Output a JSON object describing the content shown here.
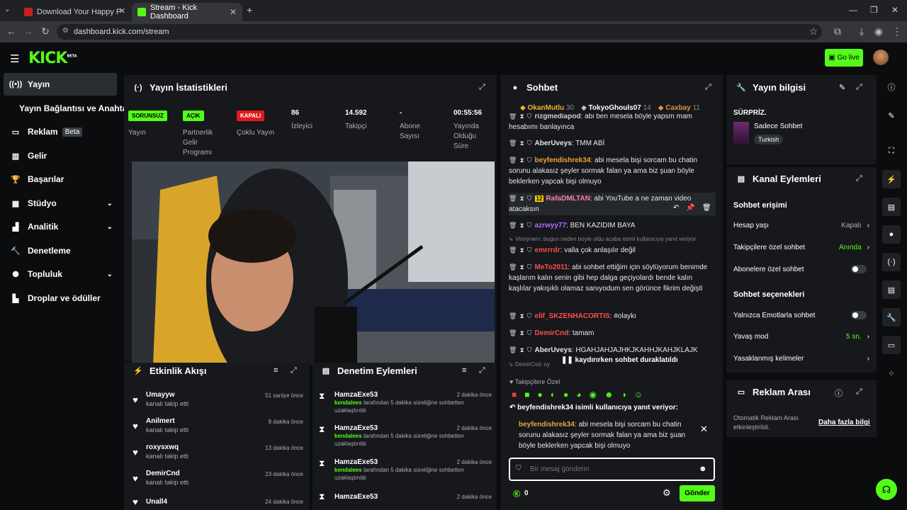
{
  "browser": {
    "tabs": [
      {
        "title": "Download Your Happy Place by",
        "active": false
      },
      {
        "title": "Stream - Kick Dashboard",
        "active": true
      }
    ],
    "url": "dashboard.kick.com/stream"
  },
  "header": {
    "logo": "KICK",
    "logo_tag": "BETA",
    "go_live": "Go live",
    "accent": "#53fc18"
  },
  "sidebar": {
    "items": [
      {
        "label": "Yayın",
        "icon": "broadcast-icon",
        "selected": true
      },
      {
        "label": "Yayın Bağlantısı ve Anahtarı",
        "icon": "",
        "selected": false
      },
      {
        "label": "Reklam",
        "icon": "ad-icon",
        "badge": "Beta"
      },
      {
        "label": "Gelir",
        "icon": "chart-icon"
      },
      {
        "label": "Başarılar",
        "icon": "trophy-icon"
      },
      {
        "label": "Stüdyo",
        "icon": "studio-icon",
        "chevron": true
      },
      {
        "label": "Analitik",
        "icon": "analytics-icon",
        "chevron": true
      },
      {
        "label": "Denetleme",
        "icon": "hammer-icon"
      },
      {
        "label": "Topluluk",
        "icon": "community-icon",
        "chevron": true
      },
      {
        "label": "Droplar ve ödüller",
        "icon": "drops-icon"
      }
    ]
  },
  "stats": {
    "title": "Yayın İstatistikleri",
    "items": [
      {
        "value": "SORUNSUZ",
        "label": "Yayın",
        "pill": "green"
      },
      {
        "value": "AÇIK",
        "label": "Partnerlik Gelir Programı",
        "pill": "green"
      },
      {
        "value": "KAPALI",
        "label": "Çoklu Yayın",
        "pill": "red"
      },
      {
        "value": "86",
        "label": "İzleyici"
      },
      {
        "value": "14.592",
        "label": "Takipçi"
      },
      {
        "value": "-",
        "label": "Abone Sayısı"
      },
      {
        "value": "00:55:56",
        "label": "Yayında Olduğu Süre"
      }
    ]
  },
  "activity": {
    "title": "Etkinlik Akışı",
    "items": [
      {
        "user": "Umayyw",
        "text": "kanalı takip etti",
        "time": "51 saniye önce"
      },
      {
        "user": "Anilmert",
        "text": "kanalı takip etti",
        "time": "9 dakika önce"
      },
      {
        "user": "roxysxwq",
        "text": "kanalı takip etti",
        "time": "13 dakika önce"
      },
      {
        "user": "DemirCnd",
        "text": "kanalı takip etti",
        "time": "23 dakika önce"
      },
      {
        "user": "Unall4",
        "text": "",
        "time": "24 dakika önce"
      }
    ]
  },
  "moderation": {
    "title": "Denetim Eylemleri",
    "items": [
      {
        "user": "HamzaExe53",
        "time": "2 dakika önce",
        "target": "kendalees",
        "text": "tarafından 5 dakika süreliğine sohbetten uzaklaştırıldı"
      },
      {
        "user": "HamzaExe53",
        "time": "2 dakika önce",
        "target": "kendalees",
        "text": "tarafından 5 dakika süreliğine sohbetten uzaklaştırıldı"
      },
      {
        "user": "HamzaExe53",
        "time": "2 dakika önce",
        "target": "kendalees",
        "text": "tarafından 5 dakika süreliğine sohbetten uzaklaştırıldı"
      },
      {
        "user": "HamzaExe53",
        "time": "2 dakika önce",
        "target": "",
        "text": ""
      }
    ]
  },
  "chat": {
    "title": "Sohbet",
    "top_gifters": [
      {
        "name": "OkanMutlu",
        "count": "30",
        "color": "#f0b232"
      },
      {
        "name": "TokyoGhouls07",
        "count": "14",
        "color": "#c0c0c0"
      },
      {
        "name": "Caxbay",
        "count": "11",
        "color": "#e0904a"
      }
    ],
    "messages": [
      {
        "user": "rizgmediapod",
        "color": "#d0d0d0",
        "text": "abi ben mesela böyle yapsm mam hesabımı banlayınca"
      },
      {
        "user": "AberUveys",
        "color": "#ffffff",
        "text": "TMM ABİ"
      },
      {
        "user": "beyfendishrek34",
        "color": "#f2a33a",
        "text": "abi mesela bişi sorcam bu chatin sorunu alakasız şeyler sormak falan ya ama biz şuan böyle beklerken yapcak bişi olmuyo"
      },
      {
        "user": "RafaDMLTAN",
        "color": "#ff7fa8",
        "badge": "12",
        "text": "abi YouTube a ne zaman video atacaksın"
      },
      {
        "user": "azrwyy77",
        "color": "#b36bff",
        "text": "BEN KAZIDIM BAYA"
      },
      {
        "user": "emrrrdr",
        "color": "#ff4d4d",
        "reply": "Vinnynerv: bugun neden boyle oldu acaba isimli kullanıcıya yanıt veriyor",
        "text": "valla çok anlaşılır değil"
      },
      {
        "user": "MeTo2011",
        "color": "#ff4d4d",
        "text": "abi sohbet ettiğim için söylüyorum benimde kaşlarım kalın senin gibi hep dalga geçiyolardı bende kalın kaşlılar yakışıklı olamaz sanıyodum sen görünce fikrim değişti"
      },
      {
        "user": "elif_SKZENHACORTIS",
        "color": "#ff4d4d",
        "text": "#olaykı"
      },
      {
        "user": "DemirCnd",
        "color": "#ff4d4d",
        "text": "tamam"
      },
      {
        "user": "AberUveys",
        "color": "#ffffff",
        "text": "HGAHJAHJAJHKJKAHHJKAHJKLAJK"
      }
    ],
    "paused": "kaydırırken sohbet duraklatıldı",
    "paused_reply": "DemirCnd: oy",
    "followers_only": "Takipçilere Özel",
    "reply_header": "beyfendishrek34 isimli kullanıcıya yanıt veriyor:",
    "reply_user": "beyfendishrek34",
    "reply_text": "abi mesela bişi sorcam bu chatin sorunu alakasız şeyler sormak falan ya ama biz şuan böyle beklerken yapcak bişi olmuyo",
    "placeholder": "Bir mesaj gönderin",
    "points": "0",
    "send": "Gönder"
  },
  "stream_info": {
    "title": "Yayın bilgisi",
    "name": "SÜRPRİZ.",
    "category": "Sadece Sohbet",
    "tag": "Turkish"
  },
  "channel_actions": {
    "title": "Kanal Eylemleri",
    "access_title": "Sohbet erişimi",
    "account_age": {
      "label": "Hesap yaşı",
      "value": "Kapalı"
    },
    "follower_only": {
      "label": "Takipçilere özel sohbet",
      "value": "Anında"
    },
    "sub_only": {
      "label": "Abonelere özel sohbet"
    },
    "options_title": "Sohbet seçenekleri",
    "emote_only": {
      "label": "Yalnızca Emotlarla sohbet"
    },
    "slow_mode": {
      "label": "Yavaş mod",
      "value": "5 sn."
    },
    "banned_words": {
      "label": "Yasaklanmış kelimeler"
    }
  },
  "ad_break": {
    "title": "Reklam Arası",
    "text": "Otomatik Reklam Arası etkinleştirildi.",
    "link": "Daha fazla bilgi"
  }
}
